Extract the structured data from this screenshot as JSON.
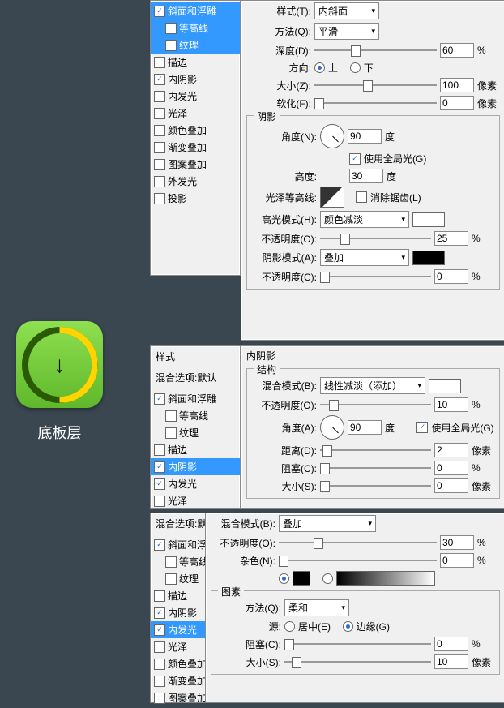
{
  "preview_caption": "底板层",
  "panel1": {
    "effects": [
      {
        "label": "斜面和浮雕",
        "checked": true,
        "sel": true
      },
      {
        "label": "等高线",
        "checked": false,
        "sel": true,
        "indent": true
      },
      {
        "label": "纹理",
        "checked": false,
        "sel": true,
        "indent": true
      },
      {
        "label": "描边",
        "checked": false
      },
      {
        "label": "内阴影",
        "checked": true
      },
      {
        "label": "内发光",
        "checked": false
      },
      {
        "label": "光泽",
        "checked": false
      },
      {
        "label": "颜色叠加",
        "checked": false
      },
      {
        "label": "渐变叠加",
        "checked": false
      },
      {
        "label": "图案叠加",
        "checked": false
      },
      {
        "label": "外发光",
        "checked": false
      },
      {
        "label": "投影",
        "checked": false
      }
    ],
    "style_label": "样式(T):",
    "style_value": "内斜面",
    "method_label": "方法(Q):",
    "method_value": "平滑",
    "depth_label": "深度(D):",
    "depth_value": "60",
    "percent": "%",
    "direction_label": "方向:",
    "dir_up": "上",
    "dir_down": "下",
    "size_label": "大小(Z):",
    "size_value": "100",
    "px": "像素",
    "soften_label": "软化(F):",
    "soften_value": "0",
    "shadow_group": "阴影",
    "angle_label": "角度(N):",
    "angle_value": "90",
    "deg": "度",
    "global_light": "使用全局光(G)",
    "altitude_label": "高度:",
    "altitude_value": "30",
    "gloss_label": "光泽等高线:",
    "antialias": "消除锯齿(L)",
    "hl_mode_label": "高光模式(H):",
    "hl_mode_value": "颜色减淡",
    "hl_opacity_label": "不透明度(O):",
    "hl_opacity_value": "25",
    "sh_mode_label": "阴影模式(A):",
    "sh_mode_value": "叠加",
    "sh_opacity_label": "不透明度(C):",
    "sh_opacity_value": "0"
  },
  "panel2": {
    "styles_hdr": "样式",
    "blend_hdr": "混合选项:默认",
    "effects": [
      {
        "label": "斜面和浮雕",
        "checked": true
      },
      {
        "label": "等高线",
        "checked": false,
        "indent": true
      },
      {
        "label": "纹理",
        "checked": false,
        "indent": true
      },
      {
        "label": "描边",
        "checked": false
      },
      {
        "label": "内阴影",
        "checked": true,
        "sel": true
      },
      {
        "label": "内发光",
        "checked": true
      },
      {
        "label": "光泽",
        "checked": false
      }
    ],
    "title": "内阴影",
    "struct": "结构",
    "blend_label": "混合模式(B):",
    "blend_value": "线性减淡（添加）",
    "opacity_label": "不透明度(O):",
    "opacity_value": "10",
    "angle_label": "角度(A):",
    "angle_value": "90",
    "global_light": "使用全局光(G)",
    "distance_label": "距离(D):",
    "distance_value": "2",
    "choke_label": "阻塞(C):",
    "choke_value": "0",
    "size_label": "大小(S):",
    "size_value": "0"
  },
  "panel3": {
    "blend_hdr": "混合选项:默认",
    "effects": [
      {
        "label": "斜面和浮雕",
        "checked": true
      },
      {
        "label": "等高线",
        "checked": false,
        "indent": true
      },
      {
        "label": "纹理",
        "checked": false,
        "indent": true
      },
      {
        "label": "描边",
        "checked": false
      },
      {
        "label": "内阴影",
        "checked": true
      },
      {
        "label": "内发光",
        "checked": true,
        "sel": true
      },
      {
        "label": "光泽",
        "checked": false
      },
      {
        "label": "颜色叠加",
        "checked": false
      },
      {
        "label": "渐变叠加",
        "checked": false
      },
      {
        "label": "图案叠加",
        "checked": false
      }
    ],
    "blend_label": "混合模式(B):",
    "blend_value": "叠加",
    "opacity_label": "不透明度(O):",
    "opacity_value": "30",
    "noise_label": "杂色(N):",
    "noise_value": "0",
    "elements": "图素",
    "method_label": "方法(Q):",
    "method_value": "柔和",
    "source_label": "源:",
    "center": "居中(E)",
    "edge": "边缘(G)",
    "choke_label": "阻塞(C):",
    "choke_value": "0",
    "size_label": "大小(S):",
    "size_value": "10"
  },
  "percent": "%",
  "px": "像素",
  "deg": "度"
}
